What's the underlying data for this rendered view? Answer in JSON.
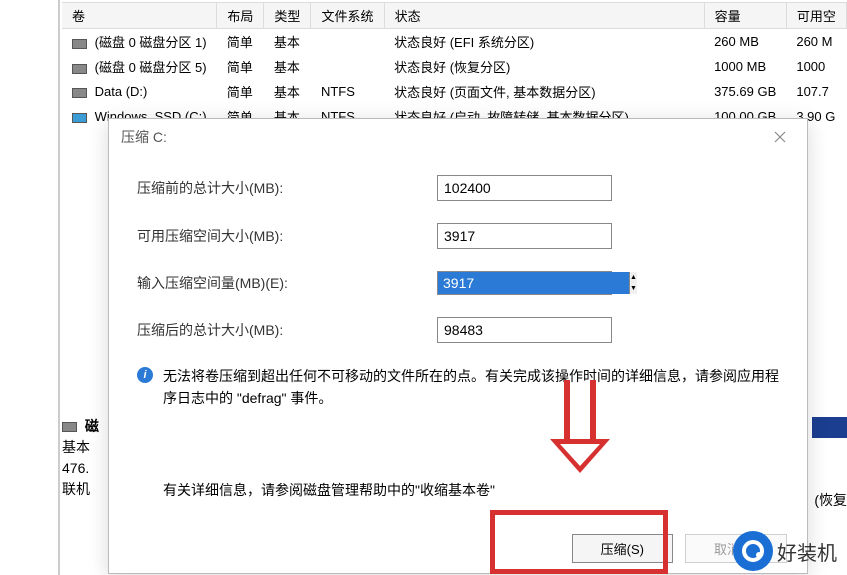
{
  "table": {
    "headers": [
      "卷",
      "布局",
      "类型",
      "文件系统",
      "状态",
      "容量",
      "可用空"
    ],
    "rows": [
      {
        "name": "(磁盘 0 磁盘分区 1)",
        "layout": "简单",
        "type": "基本",
        "fs": "",
        "status": "状态良好 (EFI 系统分区)",
        "cap": "260 MB",
        "free": "260 M"
      },
      {
        "name": "(磁盘 0 磁盘分区 5)",
        "layout": "简单",
        "type": "基本",
        "fs": "",
        "status": "状态良好 (恢复分区)",
        "cap": "1000 MB",
        "free": "1000"
      },
      {
        "name": "Data (D:)",
        "layout": "简单",
        "type": "基本",
        "fs": "NTFS",
        "status": "状态良好 (页面文件, 基本数据分区)",
        "cap": "375.69 GB",
        "free": "107.7"
      },
      {
        "name": "Windows_SSD (C:)",
        "layout": "简单",
        "type": "基本",
        "fs": "NTFS",
        "status": "状态良好 (启动, 故障转储, 基本数据分区)",
        "cap": "100.00 GB",
        "free": "3.90 G"
      }
    ]
  },
  "dialog": {
    "title": "压缩 C:",
    "labels": {
      "total_before": "压缩前的总计大小(MB):",
      "avail_shrink": "可用压缩空间大小(MB):",
      "enter_amount": "输入压缩空间量(MB)(E):",
      "total_after": "压缩后的总计大小(MB):"
    },
    "values": {
      "total_before": "102400",
      "avail_shrink": "3917",
      "enter_amount": "3917",
      "total_after": "98483"
    },
    "info_text": "无法将卷压缩到超出任何不可移动的文件所在的点。有关完成该操作时间的详细信息，请参阅应用程序日志中的 \"defrag\" 事件。",
    "help_text": "有关详细信息，请参阅磁盘管理帮助中的\"收缩基本卷\"",
    "btn_shrink": "压缩(S)",
    "btn_cancel": "取消(C)"
  },
  "left_panel": {
    "line1": "磁",
    "line2": "基本",
    "line3": "476.",
    "line4": "联机"
  },
  "right_panel": {
    "text": "(恢复"
  },
  "watermark": "好装机"
}
